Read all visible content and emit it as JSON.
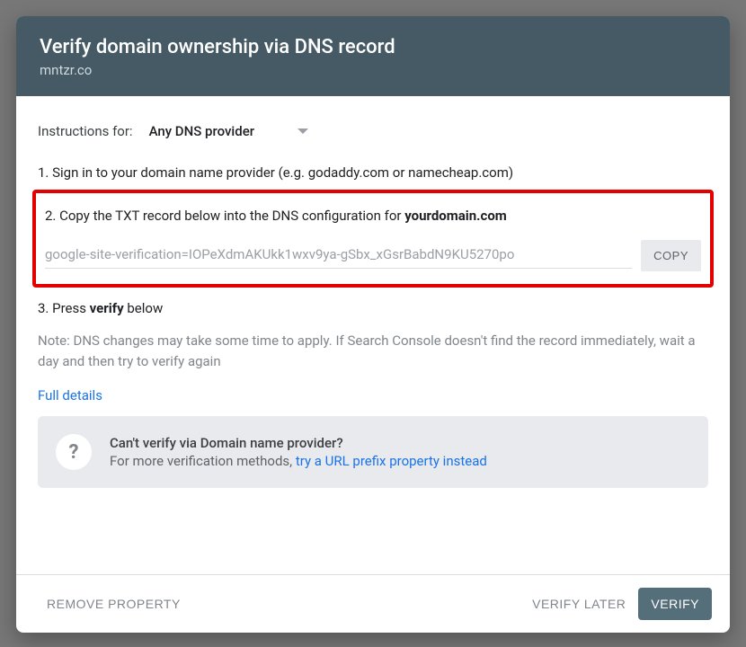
{
  "header": {
    "title": "Verify domain ownership via DNS record",
    "domain": "mntzr.co"
  },
  "instructions": {
    "label": "Instructions for:",
    "provider_selected": "Any DNS provider"
  },
  "steps": {
    "s1": "1. Sign in to your domain name provider (e.g. godaddy.com or namecheap.com)",
    "s2_prefix": "2. Copy the TXT record below into the DNS configuration for ",
    "s2_bold": "yourdomain.com",
    "txt_value": "google-site-verification=IOPeXdmAKUkk1wxv9ya-gSbx_xGsrBabdN9KU5270po",
    "copy_label": "COPY",
    "s3_prefix": "3. Press ",
    "s3_bold": "verify",
    "s3_suffix": " below"
  },
  "note": "Note: DNS changes may take some time to apply. If Search Console doesn't find the record immediately, wait a day and then try to verify again",
  "full_details": "Full details",
  "alt": {
    "title": "Can't verify via Domain name provider?",
    "sub_prefix": "For more verification methods, ",
    "sub_link": "try a URL prefix property instead",
    "icon": "?"
  },
  "footer": {
    "remove": "REMOVE PROPERTY",
    "later": "VERIFY LATER",
    "verify": "VERIFY"
  }
}
